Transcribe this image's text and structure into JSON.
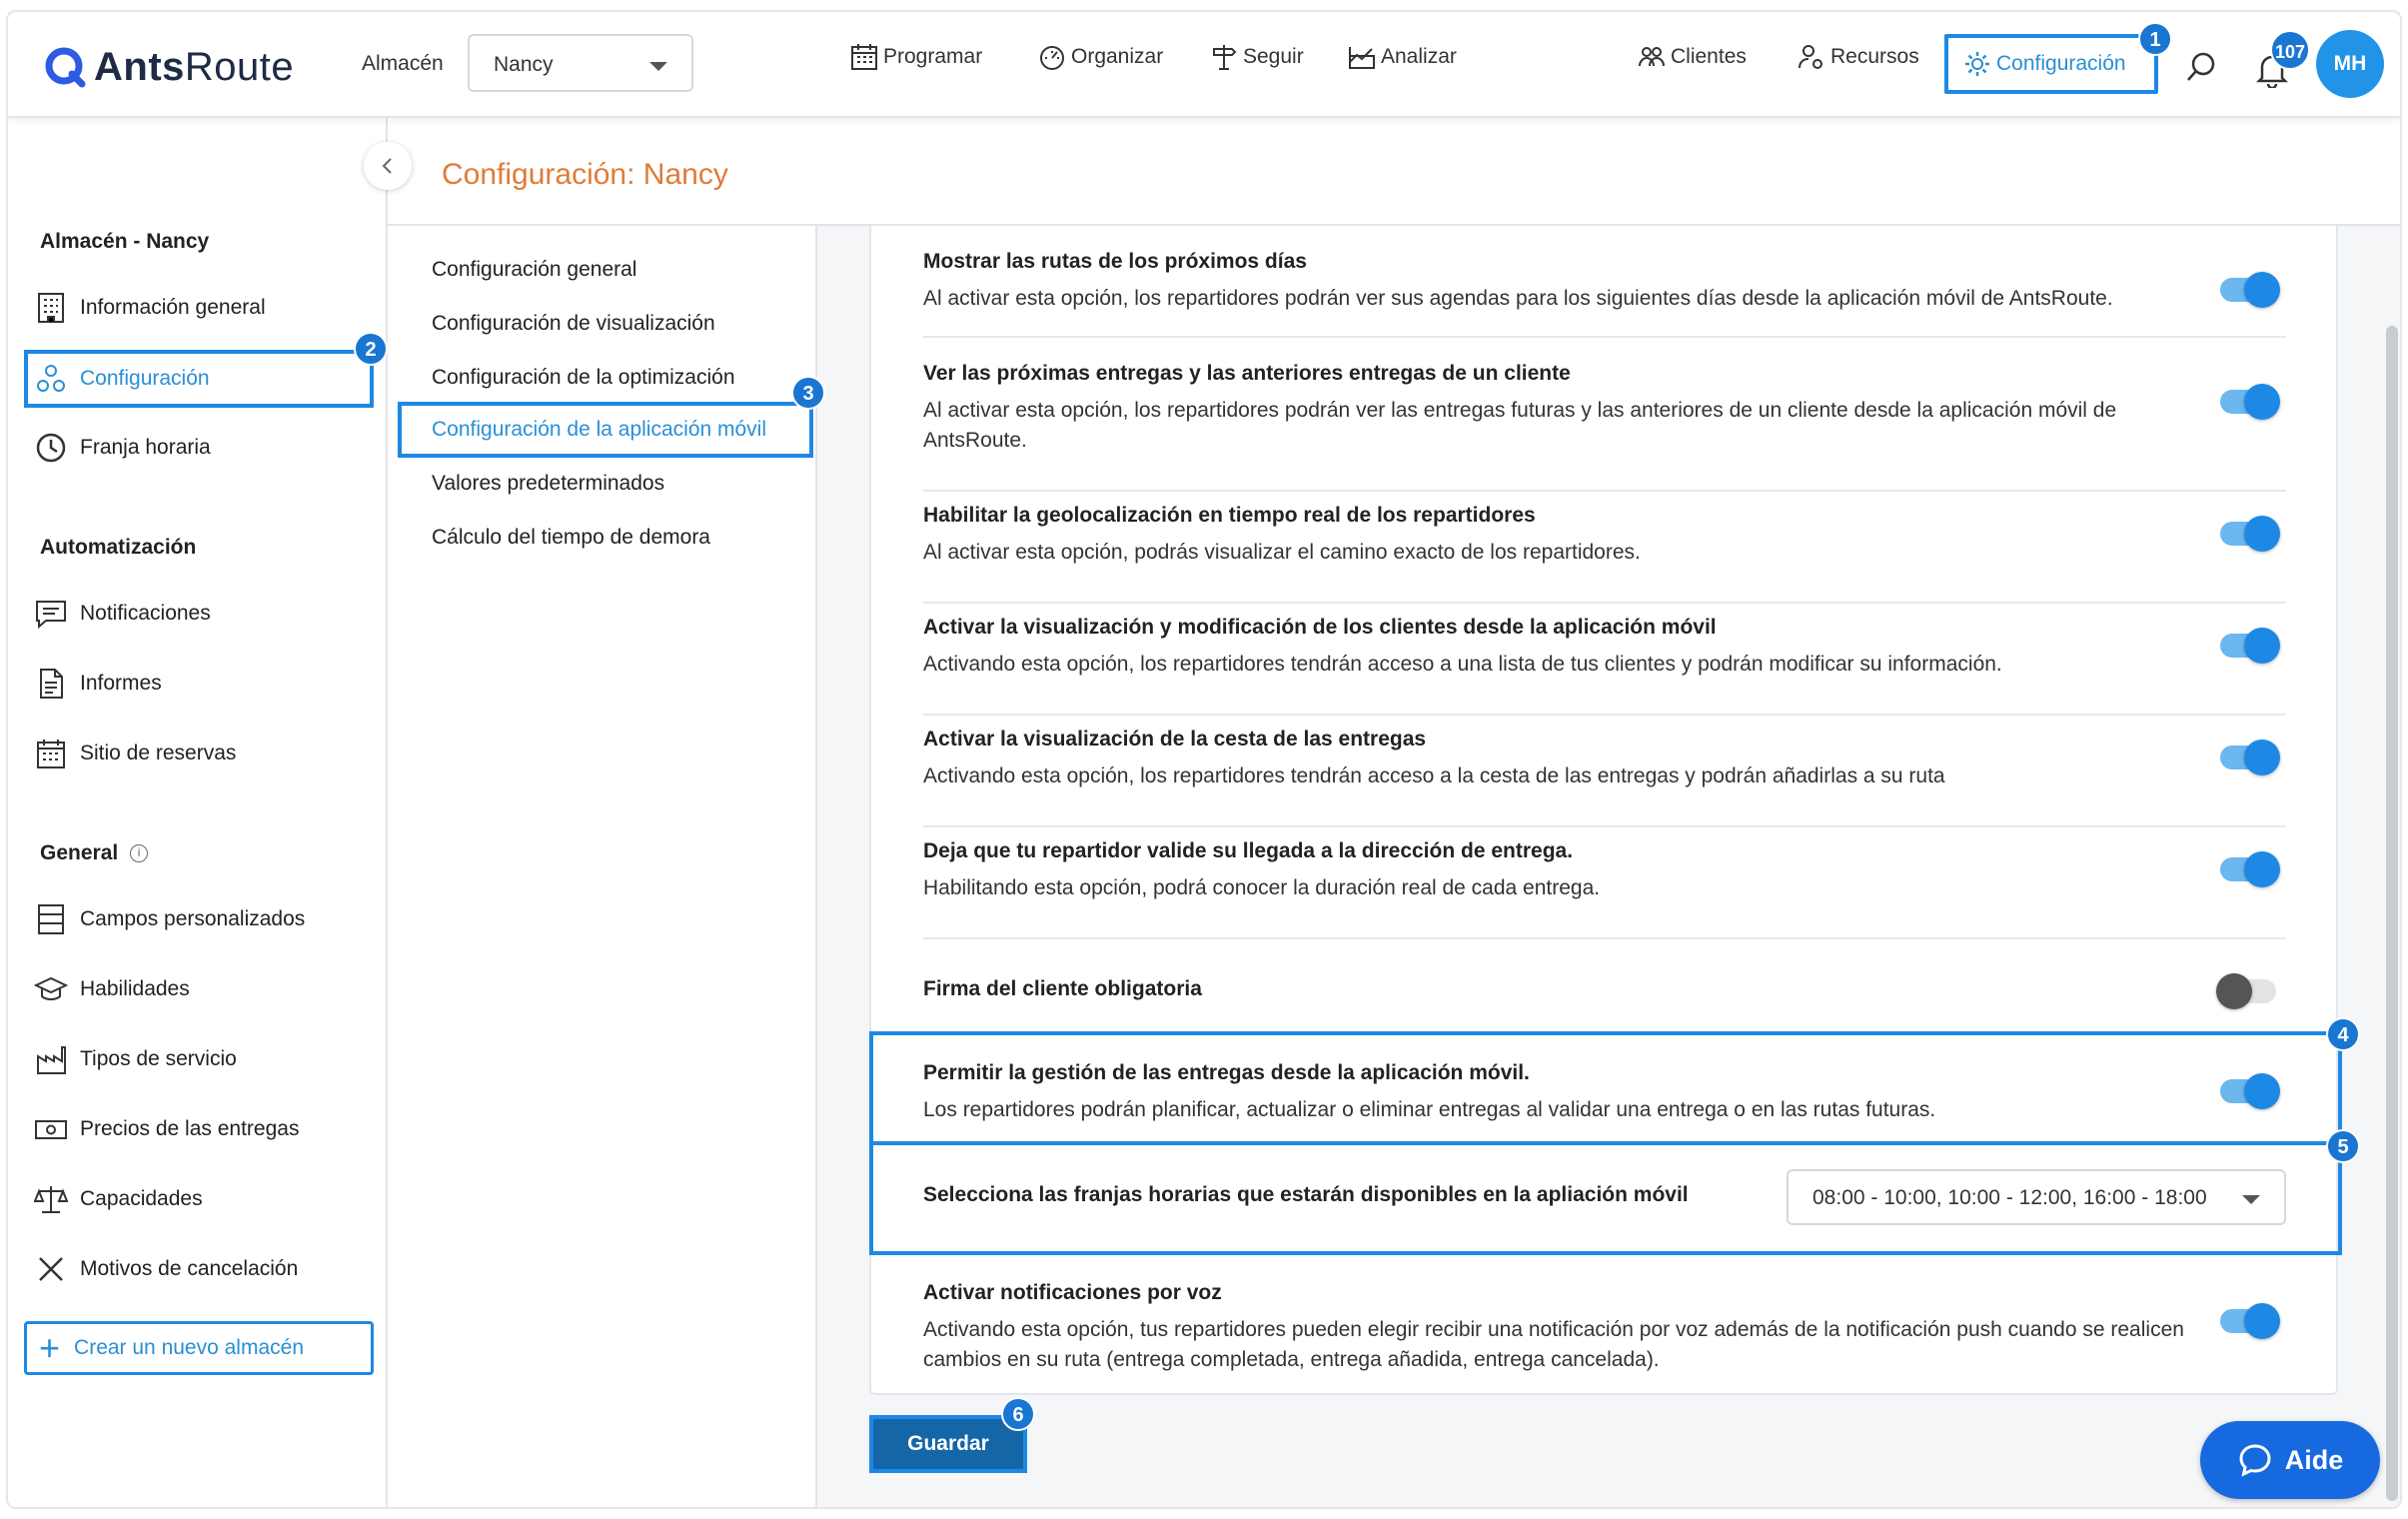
{
  "brand": {
    "name_part1": "Ants",
    "name_part2": "Route"
  },
  "header": {
    "store_label": "Almacén",
    "store_value": "Nancy",
    "nav": [
      "Programar",
      "Organizar",
      "Seguir",
      "Analizar"
    ],
    "right_nav": [
      "Clientes",
      "Recursos"
    ],
    "config_label": "Configuración",
    "notification_count": "107",
    "avatar_initials": "MH"
  },
  "markers": [
    "1",
    "2",
    "3",
    "4",
    "5",
    "6"
  ],
  "sidebar": {
    "sections": [
      {
        "title": "Almacén - Nancy",
        "items": [
          "Información general",
          "Configuración",
          "Franja horaria"
        ]
      },
      {
        "title": "Automatización",
        "items": [
          "Notificaciones",
          "Informes",
          "Sitio de reservas"
        ]
      },
      {
        "title": "General",
        "items": [
          "Campos personalizados",
          "Habilidades",
          "Tipos de servicio",
          "Precios de las entregas",
          "Capacidades",
          "Motivos de cancelación"
        ]
      }
    ],
    "create_label": "Crear un nuevo almacén"
  },
  "page_title": "Configuración: Nancy",
  "submenu": [
    "Configuración general",
    "Configuración de visualización",
    "Configuración de la optimización",
    "Configuración de la aplicación móvil",
    "Valores predeterminados",
    "Cálculo del tiempo de demora"
  ],
  "settings": [
    {
      "title": "Mostrar las rutas de los próximos días",
      "desc": "Al activar esta opción, los repartidores podrán ver sus agendas para los siguientes días desde la aplicación móvil de AntsRoute.",
      "on": true
    },
    {
      "title": "Ver las próximas entregas y las anteriores entregas de un cliente",
      "desc": "Al activar esta opción, los repartidores podrán ver las entregas futuras y las anteriores de un cliente desde la aplicación móvil de AntsRoute.",
      "on": true
    },
    {
      "title": "Habilitar la geolocalización en tiempo real de los repartidores",
      "desc": "Al activar esta opción, podrás visualizar el camino exacto de los repartidores.",
      "on": true
    },
    {
      "title": "Activar la visualización y modificación de los clientes desde la aplicación móvil",
      "desc": "Activando esta opción, los repartidores tendrán acceso a una lista de tus clientes y podrán modificar su información.",
      "on": true
    },
    {
      "title": "Activar la visualización de la cesta de las entregas",
      "desc": "Activando esta opción, los repartidores tendrán acceso a la cesta de las entregas y podrán añadirlas a su ruta",
      "on": true
    },
    {
      "title": "Deja que tu repartidor valide su llegada a la dirección de entrega.",
      "desc": "Habilitando esta opción, podrá conocer la duración real de cada entrega.",
      "on": true
    },
    {
      "title": "Firma del cliente obligatoria",
      "desc": "",
      "on": false
    },
    {
      "title": "Permitir la gestión de las entregas desde la aplicación móvil.",
      "desc": "Los repartidores podrán planificar, actualizar o eliminar entregas al validar una entrega o en las rutas futuras.",
      "on": true
    }
  ],
  "time_slots": {
    "label": "Selecciona las franjas horarias que estarán disponibles en la apliación móvil",
    "value": "08:00 - 10:00, 10:00 - 12:00, 16:00 - 18:00"
  },
  "voice": {
    "title": "Activar notificaciones por voz",
    "desc": "Activando esta opción, tus repartidores pueden elegir recibir una notificación por voz además de la notificación push cuando se realicen cambios en su ruta (entrega completada, entrega añadida, entrega cancelada).",
    "on": true
  },
  "save_label": "Guardar",
  "help_label": "Aide"
}
